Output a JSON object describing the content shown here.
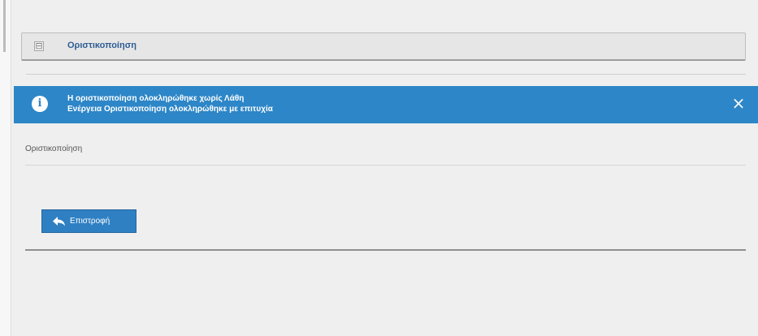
{
  "section": {
    "title": "Οριστικοποίηση",
    "toggle_symbol": "⊟"
  },
  "alert": {
    "line1": "Η οριστικοποίηση ολοκληρώθηκε χωρίς Λάθη",
    "line2": "Ενέργεια Οριστικοποίηση ολοκληρώθηκε με επιτυχία",
    "icon_symbol": "i",
    "close_symbol": "×",
    "color": "#2d86c7"
  },
  "subsection": {
    "title": "Οριστικοποίηση"
  },
  "actions": {
    "back_label": "Επιστροφή",
    "back_icon": "reply-arrow-icon",
    "button_color": "#2f80c2"
  }
}
